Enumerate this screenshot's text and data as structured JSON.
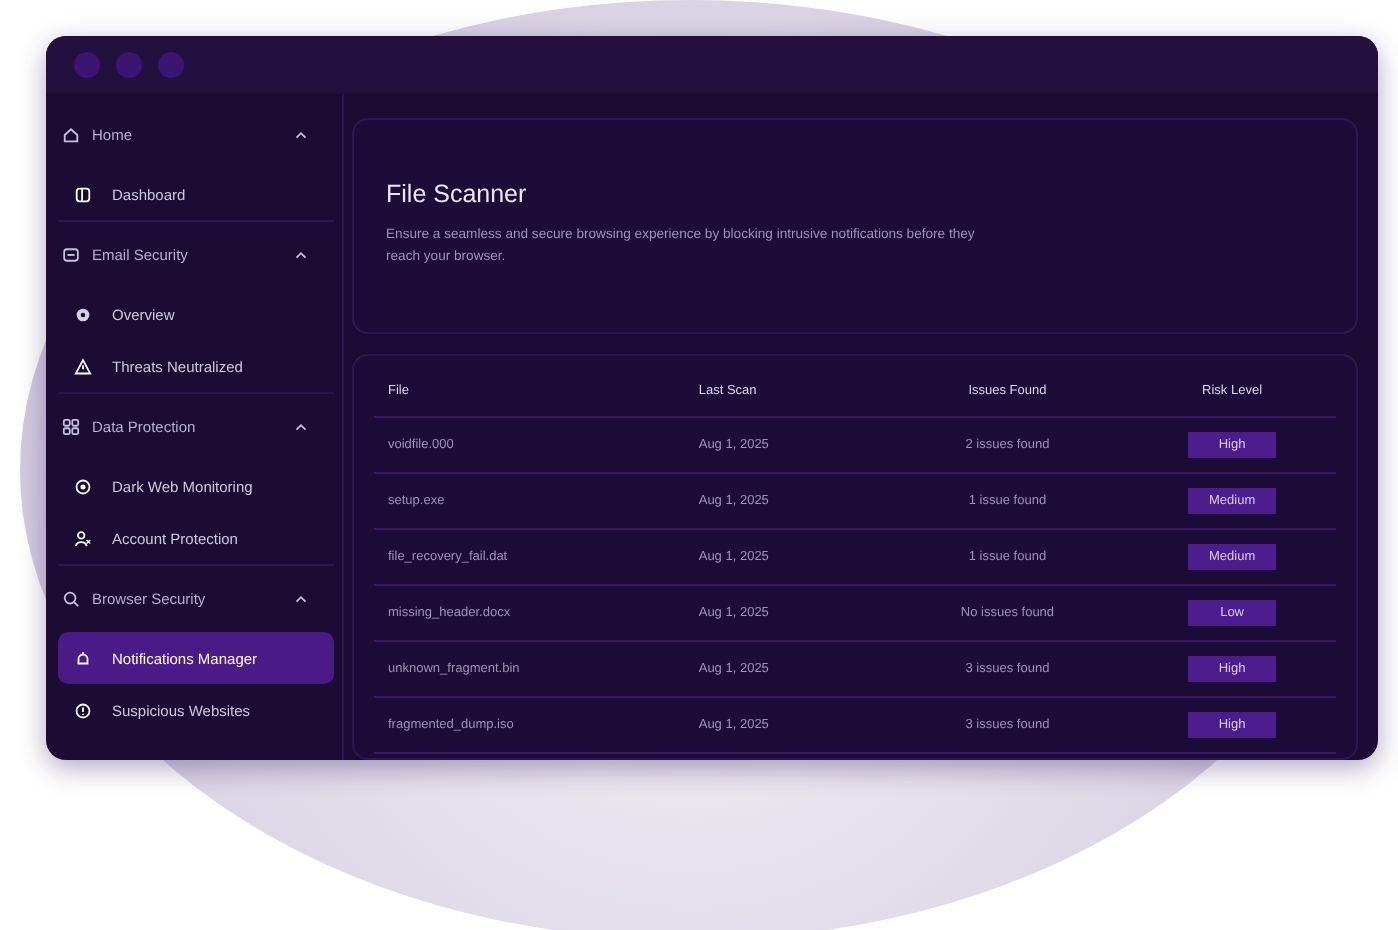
{
  "sidebar": {
    "groups": [
      {
        "label": "Home",
        "expanded": true,
        "items": [
          {
            "label": "Dashboard",
            "selected": false
          }
        ]
      },
      {
        "label": "Email Security",
        "expanded": true,
        "items": [
          {
            "label": "Overview",
            "selected": false
          },
          {
            "label": "Threats Neutralized",
            "selected": false
          }
        ]
      },
      {
        "label": "Data Protection",
        "expanded": true,
        "items": [
          {
            "label": "Dark Web Monitoring",
            "selected": false
          },
          {
            "label": "Account Protection",
            "selected": false
          }
        ]
      },
      {
        "label": "Browser Security",
        "expanded": true,
        "items": [
          {
            "label": "Notifications Manager",
            "selected": true
          },
          {
            "label": "Suspicious Websites",
            "selected": false
          }
        ]
      }
    ]
  },
  "header": {
    "title": "File Scanner",
    "description": "Ensure a seamless and secure browsing experience by blocking intrusive notifications before they reach your browser."
  },
  "table": {
    "columns": [
      "File",
      "Last Scan",
      "Issues Found",
      "Risk Level"
    ],
    "rows": [
      {
        "file": "voidfile.000",
        "last_scan": "Aug 1, 2025",
        "issues": "2 issues found",
        "risk": "High"
      },
      {
        "file": "setup.exe",
        "last_scan": "Aug 1, 2025",
        "issues": "1 issue found",
        "risk": "Medium"
      },
      {
        "file": "file_recovery_fail.dat",
        "last_scan": "Aug 1, 2025",
        "issues": "1 issue found",
        "risk": "Medium"
      },
      {
        "file": "missing_header.docx",
        "last_scan": "Aug 1, 2025",
        "issues": "No issues found",
        "risk": "Low"
      },
      {
        "file": "unknown_fragment.bin",
        "last_scan": "Aug 1, 2025",
        "issues": "3 issues found",
        "risk": "High"
      },
      {
        "file": "fragmented_dump.iso",
        "last_scan": "Aug 1, 2025",
        "issues": "3 issues found",
        "risk": "High"
      }
    ]
  }
}
